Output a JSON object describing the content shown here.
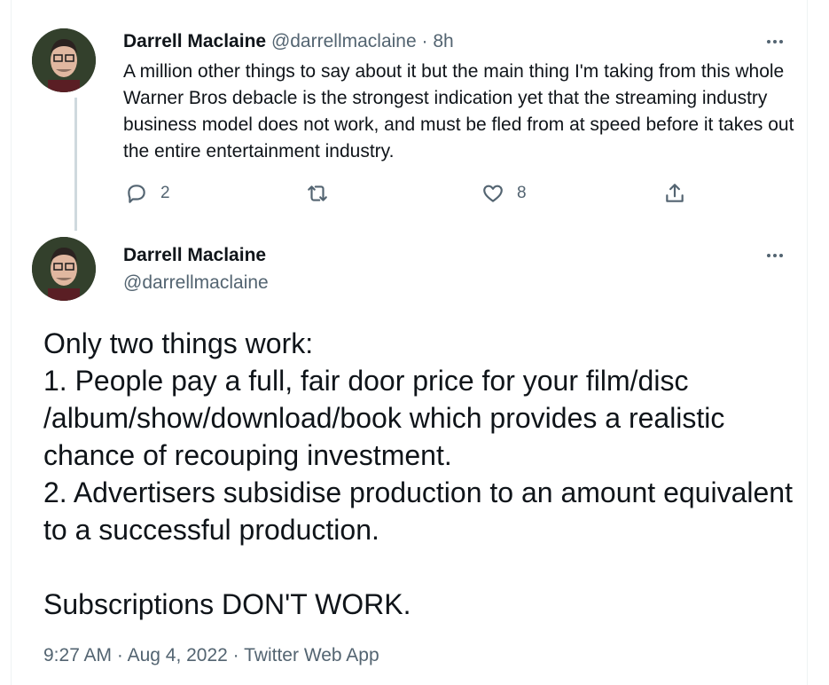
{
  "reply_tweet": {
    "author_name": "Darrell Maclaine",
    "author_handle": "@darrellmaclaine",
    "separator": " · ",
    "time": "8h",
    "text": "A million other things to say about it but the main thing I'm taking from this whole Warner Bros debacle is the strongest indication yet that the streaming industry business model does not work, and must be fled from at speed before it takes out the entire entertainment industry.",
    "replies_count": "2",
    "likes_count": "8"
  },
  "main_tweet": {
    "author_name": "Darrell Maclaine",
    "author_handle": "@darrellmaclaine",
    "text": "Only two things work:\n1. People pay a full, fair door price for your film/disc\n/album/show/download/book which provides a realistic chance of recouping investment.\n2. Advertisers subsidise production to an amount equivalent to a successful production.\n\nSubscriptions DON'T WORK.",
    "time": "9:27 AM",
    "date": "Aug 4, 2022",
    "client": "Twitter Web App",
    "meta_separator": " · "
  },
  "icons": [
    "avatar",
    "more-icon",
    "reply-icon",
    "retweet-icon",
    "like-icon",
    "share-icon"
  ]
}
